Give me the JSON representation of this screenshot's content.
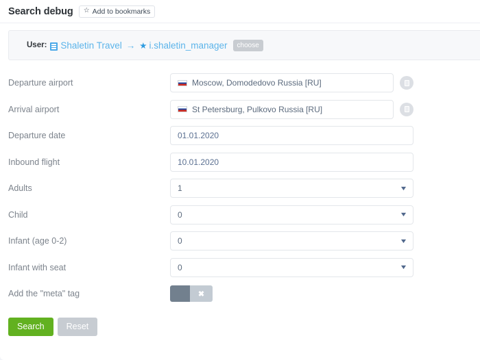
{
  "header": {
    "title": "Search debug",
    "bookmark_label": "Add to bookmarks",
    "star_icon": "star-outline-icon"
  },
  "userbar": {
    "label": "User:",
    "org_icon": "office-building-icon",
    "org_name": "Shaletin Travel",
    "arrow": "→",
    "star_icon": "★",
    "user_name": "i.shaletin_manager",
    "choose_label": "choose"
  },
  "form": {
    "rows": [
      {
        "label": "Departure airport",
        "type": "text-flag",
        "value": "Moscow, Domodedovo Russia [RU]",
        "flag": "ru-flag-icon",
        "has_clear": true
      },
      {
        "label": "Arrival airport",
        "type": "text-flag",
        "value": "St Petersburg, Pulkovo Russia [RU]",
        "flag": "ru-flag-icon",
        "has_clear": true
      },
      {
        "label": "Departure date",
        "type": "date",
        "value": "01.01.2020",
        "has_clear": false
      },
      {
        "label": "Inbound flight",
        "type": "date",
        "value": "10.01.2020",
        "has_clear": false
      },
      {
        "label": "Adults",
        "type": "select",
        "value": "1",
        "has_clear": false
      },
      {
        "label": "Child",
        "type": "select",
        "value": "0",
        "has_clear": false
      },
      {
        "label": "Infant (age 0-2)",
        "type": "select",
        "value": "0",
        "has_clear": false
      },
      {
        "label": "Infant with seat",
        "type": "select",
        "value": "0",
        "has_clear": false
      },
      {
        "label": "Add the \"meta\" tag",
        "type": "toggle",
        "value": "off",
        "toggle_mark": "✖",
        "has_clear": false
      }
    ]
  },
  "actions": {
    "search_label": "Search",
    "reset_label": "Reset"
  },
  "colors": {
    "accent_green": "#62b120",
    "link_blue": "#5cb4ea",
    "muted_gray": "#c7ccd2",
    "page_bg": "#f2f3f8"
  }
}
